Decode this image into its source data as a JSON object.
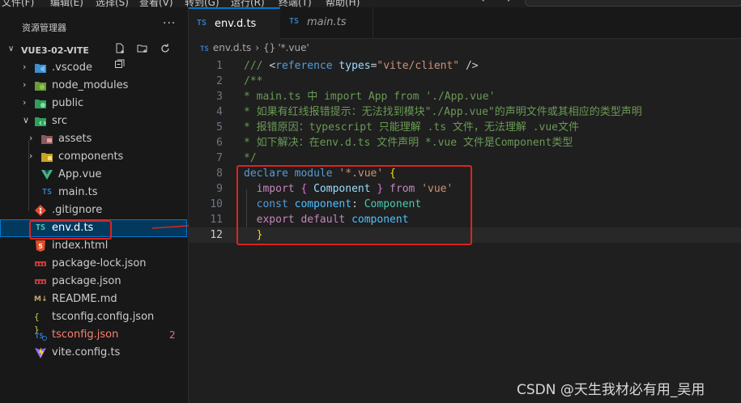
{
  "menubar": {
    "items": [
      "文件(F)",
      "编辑(E)",
      "选择(S)",
      "查看(V)",
      "转到(G)",
      "运行(R)",
      "终端(T)",
      "帮助(H)"
    ],
    "nav_back": "←",
    "nav_forward": "→"
  },
  "sidebar": {
    "title": "资源管理器",
    "more": "···",
    "project": {
      "name": "VUE3-02-VITE",
      "actions": [
        "new-file-icon",
        "new-folder-icon",
        "refresh-icon",
        "collapse-all-icon"
      ]
    },
    "items": [
      {
        "label": ".vscode",
        "kind": "folder",
        "expanded": false,
        "icon": "vscode-folder-icon"
      },
      {
        "label": "node_modules",
        "kind": "folder",
        "expanded": false,
        "icon": "node-folder-icon"
      },
      {
        "label": "public",
        "kind": "folder",
        "expanded": false,
        "icon": "public-folder-icon"
      },
      {
        "label": "src",
        "kind": "folder",
        "expanded": true,
        "icon": "src-folder-icon"
      },
      {
        "label": "assets",
        "kind": "folder",
        "expanded": false,
        "icon": "assets-folder-icon"
      },
      {
        "label": "components",
        "kind": "folder",
        "expanded": false,
        "icon": "components-folder-icon"
      },
      {
        "label": "App.vue",
        "kind": "file",
        "icon": "vue-icon"
      },
      {
        "label": "main.ts",
        "kind": "file",
        "icon": "ts-icon",
        "badge_text": "TS"
      },
      {
        "label": ".gitignore",
        "kind": "file",
        "icon": "git-icon"
      },
      {
        "label": "env.d.ts",
        "kind": "file",
        "icon": "ts-icon",
        "badge_text": "TS",
        "selected": true
      },
      {
        "label": "index.html",
        "kind": "file",
        "icon": "html-icon"
      },
      {
        "label": "package-lock.json",
        "kind": "file",
        "icon": "npm-icon"
      },
      {
        "label": "package.json",
        "kind": "file",
        "icon": "npm-icon"
      },
      {
        "label": "README.md",
        "kind": "file",
        "icon": "markdown-icon",
        "badge_text": "M↓"
      },
      {
        "label": "tsconfig.config.json",
        "kind": "file",
        "icon": "json-icon",
        "badge_text": "{ }"
      },
      {
        "label": "tsconfig.json",
        "kind": "file",
        "icon": "tsconfig-icon",
        "error_count": "2"
      },
      {
        "label": "vite.config.ts",
        "kind": "file",
        "icon": "vite-icon"
      }
    ]
  },
  "tabs": [
    {
      "label": "env.d.ts",
      "badge": "TS",
      "active": true
    },
    {
      "label": "main.ts",
      "badge": "TS",
      "active": false
    }
  ],
  "breadcrumb": {
    "file": "env.d.ts",
    "badge": "TS",
    "symbol_icon": "{}",
    "symbol": "'*.vue'"
  },
  "editor": {
    "line_numbers": [
      "1",
      "2",
      "3",
      "4",
      "5",
      "6",
      "7",
      "8",
      "9",
      "10",
      "11",
      "12"
    ],
    "active_line": 12,
    "lines": [
      [
        {
          "t": "/// ",
          "c": "cm"
        },
        {
          "t": "<",
          "c": "pl"
        },
        {
          "t": "reference",
          "c": "kw"
        },
        {
          "t": " ",
          "c": "pl"
        },
        {
          "t": "types",
          "c": "attr"
        },
        {
          "t": "=",
          "c": "pl"
        },
        {
          "t": "\"vite/client\"",
          "c": "str"
        },
        {
          "t": " />",
          "c": "pl"
        }
      ],
      [
        {
          "t": "/**",
          "c": "cm"
        }
      ],
      [
        {
          "t": "* main.ts 中 import App from './App.vue'",
          "c": "cm"
        }
      ],
      [
        {
          "t": "* 如果有红线报错提示：无法找到模块\"./App.vue\"的声明文件或其相应的类型声明",
          "c": "cm"
        }
      ],
      [
        {
          "t": "* 报错原因：typescript 只能理解 .ts 文件，无法理解 .vue文件",
          "c": "cm"
        }
      ],
      [
        {
          "t": "* 如下解决：在env.d.ts 文件声明 *.vue 文件是Component类型",
          "c": "cm"
        }
      ],
      [
        {
          "t": "*/",
          "c": "cm"
        }
      ],
      [
        {
          "t": "declare",
          "c": "kw"
        },
        {
          "t": " ",
          "c": "pl"
        },
        {
          "t": "module",
          "c": "kw"
        },
        {
          "t": " ",
          "c": "pl"
        },
        {
          "t": "'*.vue'",
          "c": "str"
        },
        {
          "t": " ",
          "c": "pl"
        },
        {
          "t": "{",
          "c": "br1"
        }
      ],
      [
        {
          "t": "  ",
          "c": "pl"
        },
        {
          "t": "import",
          "c": "kw2"
        },
        {
          "t": " ",
          "c": "pl"
        },
        {
          "t": "{",
          "c": "br2"
        },
        {
          "t": " ",
          "c": "pl"
        },
        {
          "t": "Component",
          "c": "attr"
        },
        {
          "t": " ",
          "c": "pl"
        },
        {
          "t": "}",
          "c": "br2"
        },
        {
          "t": " ",
          "c": "pl"
        },
        {
          "t": "from",
          "c": "kw2"
        },
        {
          "t": " ",
          "c": "pl"
        },
        {
          "t": "'vue'",
          "c": "str"
        }
      ],
      [
        {
          "t": "  ",
          "c": "pl"
        },
        {
          "t": "const",
          "c": "kw"
        },
        {
          "t": " ",
          "c": "pl"
        },
        {
          "t": "component",
          "c": "var"
        },
        {
          "t": ": ",
          "c": "pl"
        },
        {
          "t": "Component",
          "c": "typ"
        }
      ],
      [
        {
          "t": "  ",
          "c": "pl"
        },
        {
          "t": "export",
          "c": "kw2"
        },
        {
          "t": " ",
          "c": "pl"
        },
        {
          "t": "default",
          "c": "kw2"
        },
        {
          "t": " ",
          "c": "pl"
        },
        {
          "t": "component",
          "c": "var"
        }
      ],
      [
        {
          "t": "  ",
          "c": "pl"
        },
        {
          "t": "}",
          "c": "br1"
        }
      ]
    ]
  },
  "watermark": "CSDN @天生我材必有用_吴用",
  "colors": {
    "accent": "#0078d4",
    "highlight_box": "#e0231d",
    "error": "#f88070"
  }
}
